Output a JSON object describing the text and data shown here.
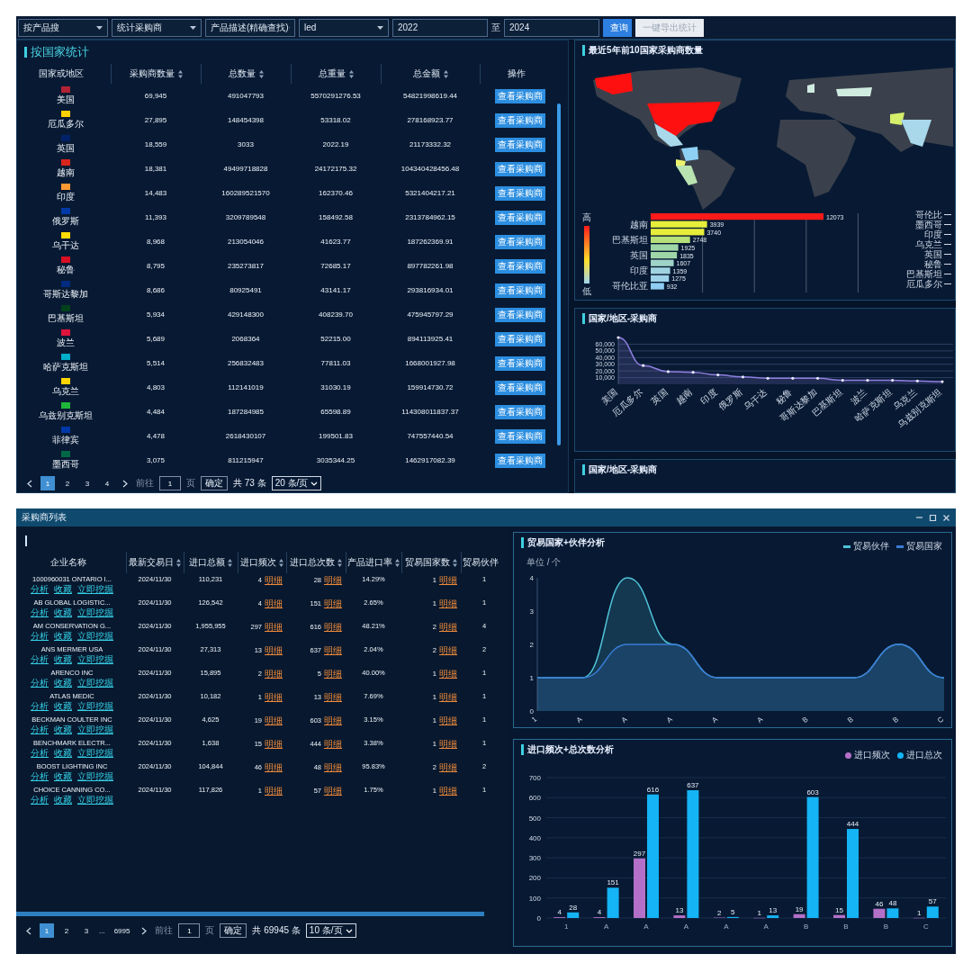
{
  "top_screen": {
    "filters": [
      {
        "kind": "select",
        "value": "按产品搜"
      },
      {
        "kind": "select",
        "value": "统计采购商"
      },
      {
        "kind": "select",
        "value": "产品描述(精确查找)"
      },
      {
        "kind": "select",
        "value": "led"
      },
      {
        "kind": "input",
        "value": "2022"
      },
      {
        "kind": "separator",
        "value": "至"
      },
      {
        "kind": "input",
        "value": "2024"
      }
    ],
    "buttons": [
      {
        "label": "查询",
        "kind": "primary"
      },
      {
        "label": "一键导出统计",
        "kind": "plain"
      }
    ],
    "country_panel": {
      "title": "按国家统计",
      "columns": [
        {
          "label": "国家或地区",
          "sortable": false
        },
        {
          "label": "采购商数量",
          "sortable": true
        },
        {
          "label": "总数量",
          "sortable": true
        },
        {
          "label": "总重量",
          "sortable": true
        },
        {
          "label": "总金额",
          "sortable": true
        },
        {
          "label": "操作",
          "sortable": false
        }
      ],
      "rows": [
        {
          "country": "美国",
          "color": "#b22234",
          "buyers": "69,945",
          "quantity": "491047793",
          "weight": "5570291276.53",
          "amount": "54821998619.44",
          "action": "查看采购商"
        },
        {
          "country": "厄瓜多尔",
          "color": "#ffd100",
          "buyers": "27,895",
          "quantity": "148454398",
          "weight": "53318.02",
          "amount": "278168923.77",
          "action": "查看采购商"
        },
        {
          "country": "英国",
          "color": "#012169",
          "buyers": "18,559",
          "quantity": "3033",
          "weight": "2022.19",
          "amount": "21173332.32",
          "action": "查看采购商"
        },
        {
          "country": "越南",
          "color": "#da251d",
          "buyers": "18,381",
          "quantity": "49499718828",
          "weight": "24172175.32",
          "amount": "104340428456.48",
          "action": "查看采购商"
        },
        {
          "country": "印度",
          "color": "#ff9933",
          "buyers": "14,483",
          "quantity": "160289521570",
          "weight": "162370.46",
          "amount": "5321404217.21",
          "action": "查看采购商"
        },
        {
          "country": "俄罗斯",
          "color": "#0039a6",
          "buyers": "11,393",
          "quantity": "3209789548",
          "weight": "158492.58",
          "amount": "2313784962.15",
          "action": "查看采购商"
        },
        {
          "country": "乌干达",
          "color": "#fcdc04",
          "buyers": "8,968",
          "quantity": "213054046",
          "weight": "41623.77",
          "amount": "187262369.91",
          "action": "查看采购商"
        },
        {
          "country": "秘鲁",
          "color": "#d91023",
          "buyers": "8,795",
          "quantity": "235273817",
          "weight": "72685.17",
          "amount": "897782261.98",
          "action": "查看采购商"
        },
        {
          "country": "哥斯达黎加",
          "color": "#002b7f",
          "buyers": "8,686",
          "quantity": "80925491",
          "weight": "43141.17",
          "amount": "293816934.01",
          "action": "查看采购商"
        },
        {
          "country": "巴基斯坦",
          "color": "#01411c",
          "buyers": "5,934",
          "quantity": "429148300",
          "weight": "408239.70",
          "amount": "475945797.29",
          "action": "查看采购商"
        },
        {
          "country": "波兰",
          "color": "#dc143c",
          "buyers": "5,689",
          "quantity": "2068364",
          "weight": "52215.00",
          "amount": "894113925.41",
          "action": "查看采购商"
        },
        {
          "country": "哈萨克斯坦",
          "color": "#00afca",
          "buyers": "5,514",
          "quantity": "256832483",
          "weight": "77811.03",
          "amount": "1668001927.98",
          "action": "查看采购商"
        },
        {
          "country": "乌克兰",
          "color": "#ffd500",
          "buyers": "4,803",
          "quantity": "112141019",
          "weight": "31030.19",
          "amount": "159914730.72",
          "action": "查看采购商"
        },
        {
          "country": "乌兹别克斯坦",
          "color": "#1eb53a",
          "buyers": "4,484",
          "quantity": "187284985",
          "weight": "65598.89",
          "amount": "114308011837.37",
          "action": "查看采购商"
        },
        {
          "country": "菲律宾",
          "color": "#0038a8",
          "buyers": "4,478",
          "quantity": "2618430107",
          "weight": "199501.83",
          "amount": "747557440.54",
          "action": "查看采购商"
        },
        {
          "country": "墨西哥",
          "color": "#006847",
          "buyers": "3,075",
          "quantity": "811215947",
          "weight": "3035344.25",
          "amount": "1462917082.39",
          "action": "查看采购商"
        }
      ],
      "pagination": {
        "pages": [
          {
            "label": "1",
            "kind": "page",
            "selected": true
          },
          {
            "label": "2",
            "kind": "page",
            "selected": false
          },
          {
            "label": "3",
            "kind": "page",
            "selected": false
          },
          {
            "label": "4",
            "kind": "page",
            "selected": false
          }
        ],
        "goto_label": "前往",
        "page_input": "1",
        "page_unit": "页",
        "confirm": "确定",
        "total": "共 73 条",
        "page_size": "20 条/页"
      }
    },
    "map_panel": {
      "title": "最近5年前10国家采购商数量",
      "legend_high": "高",
      "legend_low": "低",
      "chart_data": {
        "type": "bar",
        "orientation": "horizontal",
        "categories": [
          null,
          "越南",
          null,
          "巴基斯坦",
          null,
          "英国",
          null,
          "印度",
          null,
          "哥伦比亚"
        ],
        "values": [
          12073,
          3939,
          3740,
          2748,
          1925,
          1835,
          1607,
          1359,
          1275,
          932
        ],
        "data_labels": true
      },
      "map_labels": [
        "哥伦比",
        "墨西哥",
        "印度",
        "乌克兰",
        "英国",
        "秘鲁",
        "巴基斯坦",
        "厄瓜多尔"
      ]
    },
    "trend_panel": {
      "title": "国家/地区-采购商",
      "chart_data": {
        "type": "area",
        "grid": true,
        "ylim": [
          0,
          70000
        ],
        "categories": [
          "美国",
          "厄瓜多尔",
          "英国",
          "越南",
          "印度",
          "俄罗斯",
          "乌干达",
          "秘鲁",
          "哥斯达黎加",
          "巴基斯坦",
          "波兰",
          "哈萨克斯坦",
          "乌克兰",
          "乌兹别克斯坦"
        ],
        "series": [
          {
            "color": "#8f7fe0",
            "values": [
              70000,
              28000,
              19000,
              18000,
              14000,
              11000,
              9000,
              9000,
              9000,
              6000,
              6000,
              6000,
              5000,
              4000
            ]
          }
        ],
        "yticks": [
          {
            "value": 10000,
            "label": "10,000"
          },
          {
            "value": 20000,
            "label": "20,000"
          },
          {
            "value": 30000,
            "label": "30,000"
          },
          {
            "value": 40000,
            "label": "40,000"
          },
          {
            "value": 50000,
            "label": "50,000"
          },
          {
            "value": 60000,
            "label": "60,000"
          }
        ]
      }
    },
    "third_panel": {
      "title": "国家/地区-采购商"
    }
  },
  "buyer_window": {
    "title": "采购商列表",
    "columns": [
      {
        "label": "企业名称",
        "sortable": false
      },
      {
        "label": "最新交易日",
        "sortable": true
      },
      {
        "label": "进口总额",
        "sortable": true
      },
      {
        "label": "进口频次",
        "sortable": true
      },
      {
        "label": "进口总次数",
        "sortable": true
      },
      {
        "label": "产品进口率",
        "sortable": true
      },
      {
        "label": "贸易国家数",
        "sortable": true
      },
      {
        "label": "贸易伙伴",
        "sortable": false
      }
    ],
    "rows": [
      {
        "company": "1000960031 ONTARIO I...",
        "links": [
          "分析",
          "收藏",
          "立即挖掘"
        ],
        "date": "2024/11/30",
        "total": "110,231",
        "frequency": "4",
        "frequency_link": "明细",
        "count": "28",
        "count_link": "明细",
        "rate": "14.29%",
        "countries": "1",
        "countries_link": "明细",
        "partners": "1"
      },
      {
        "company": "AB GLOBAL LOGISTIC...",
        "links": [
          "分析",
          "收藏",
          "立即挖掘"
        ],
        "date": "2024/11/30",
        "total": "126,542",
        "frequency": "4",
        "frequency_link": "明细",
        "count": "151",
        "count_link": "明细",
        "rate": "2.65%",
        "countries": "1",
        "countries_link": "明细",
        "partners": "1"
      },
      {
        "company": "AM CONSERVATION G...",
        "links": [
          "分析",
          "收藏",
          "立即挖掘"
        ],
        "date": "2024/11/30",
        "total": "1,955,955",
        "frequency": "297",
        "frequency_link": "明细",
        "count": "616",
        "count_link": "明细",
        "rate": "48.21%",
        "countries": "2",
        "countries_link": "明细",
        "partners": "4"
      },
      {
        "company": "ANS MERMER USA",
        "links": [
          "分析",
          "收藏",
          "立即挖掘"
        ],
        "date": "2024/11/30",
        "total": "27,313",
        "frequency": "13",
        "frequency_link": "明细",
        "count": "637",
        "count_link": "明细",
        "rate": "2.04%",
        "countries": "2",
        "countries_link": "明细",
        "partners": "2"
      },
      {
        "company": "ARENCO INC",
        "links": [
          "分析",
          "收藏",
          "立即挖掘"
        ],
        "date": "2024/11/30",
        "total": "15,895",
        "frequency": "2",
        "frequency_link": "明细",
        "count": "5",
        "count_link": "明细",
        "rate": "40.00%",
        "countries": "1",
        "countries_link": "明细",
        "partners": "1"
      },
      {
        "company": "ATLAS MEDIC",
        "links": [
          "分析",
          "收藏",
          "立即挖掘"
        ],
        "date": "2024/11/30",
        "total": "10,182",
        "frequency": "1",
        "frequency_link": "明细",
        "count": "13",
        "count_link": "明细",
        "rate": "7.69%",
        "countries": "1",
        "countries_link": "明细",
        "partners": "1"
      },
      {
        "company": "BECKMAN COULTER INC",
        "links": [
          "分析",
          "收藏",
          "立即挖掘"
        ],
        "date": "2024/11/30",
        "total": "4,625",
        "frequency": "19",
        "frequency_link": "明细",
        "count": "603",
        "count_link": "明细",
        "rate": "3.15%",
        "countries": "1",
        "countries_link": "明细",
        "partners": "1"
      },
      {
        "company": "BENCHMARK ELECTR...",
        "links": [
          "分析",
          "收藏",
          "立即挖掘"
        ],
        "date": "2024/11/30",
        "total": "1,638",
        "frequency": "15",
        "frequency_link": "明细",
        "count": "444",
        "count_link": "明细",
        "rate": "3.38%",
        "countries": "1",
        "countries_link": "明细",
        "partners": "1"
      },
      {
        "company": "BOOST LIGHTING INC",
        "links": [
          "分析",
          "收藏",
          "立即挖掘"
        ],
        "date": "2024/11/30",
        "total": "104,844",
        "frequency": "46",
        "frequency_link": "明细",
        "count": "48",
        "count_link": "明细",
        "rate": "95.83%",
        "countries": "2",
        "countries_link": "明细",
        "partners": "2"
      },
      {
        "company": "CHOICE CANNING CO...",
        "links": [
          "分析",
          "收藏",
          "立即挖掘"
        ],
        "date": "2024/11/30",
        "total": "117,826",
        "frequency": "1",
        "frequency_link": "明细",
        "count": "57",
        "count_link": "明细",
        "rate": "1.75%",
        "countries": "1",
        "countries_link": "明细",
        "partners": "1"
      }
    ],
    "pagination": {
      "pages": [
        {
          "label": "1",
          "kind": "page",
          "selected": true
        },
        {
          "label": "2",
          "kind": "page",
          "selected": false
        },
        {
          "label": "3",
          "kind": "page",
          "selected": false
        },
        {
          "label": "...",
          "kind": "ellipsis"
        },
        {
          "label": "6995",
          "kind": "page",
          "selected": false
        }
      ],
      "goto_label": "前往",
      "page_input": "1",
      "page_unit": "页",
      "confirm": "确定",
      "total": "共 69945 条",
      "page_size": "10 条/页"
    },
    "trade_chart": {
      "title": "贸易国家+伙伴分析",
      "unit": "单位 / 个",
      "chart_data": {
        "type": "area",
        "categories": [
          "1",
          "A",
          "A",
          "A",
          "A",
          "A",
          "B",
          "B",
          "B",
          "C"
        ],
        "series": [
          {
            "name": "贸易伙伴",
            "color": "#4fc3d9",
            "values": [
              1,
              1,
              4,
              2,
              1,
              1,
              1,
              1,
              2,
              1
            ]
          },
          {
            "name": "贸易国家",
            "color": "#3a7bd5",
            "values": [
              1,
              1,
              2,
              2,
              1,
              1,
              1,
              1,
              2,
              1
            ]
          }
        ],
        "ylim": [
          0,
          4
        ],
        "yticks": [
          0,
          1,
          2,
          3,
          4
        ]
      }
    },
    "frequency_chart": {
      "title": "进口频次+总次数分析",
      "chart_data": {
        "type": "bar",
        "grid": true,
        "categories": [
          "1",
          "A",
          "A",
          "A",
          "A",
          "A",
          "B",
          "B",
          "B",
          "C"
        ],
        "series": [
          {
            "name": "进口频次",
            "color": "#b470c8",
            "values": [
              4,
              4,
              297,
              13,
              2,
              1,
              19,
              15,
              46,
              1
            ]
          },
          {
            "name": "进口总次",
            "color": "#14b4f5",
            "values": [
              28,
              151,
              616,
              637,
              5,
              13,
              603,
              444,
              48,
              57
            ]
          }
        ],
        "ylim": [
          0,
          700
        ],
        "yticks": [
          0,
          100,
          200,
          300,
          400,
          500,
          600,
          700
        ],
        "data_labels": true
      }
    }
  }
}
